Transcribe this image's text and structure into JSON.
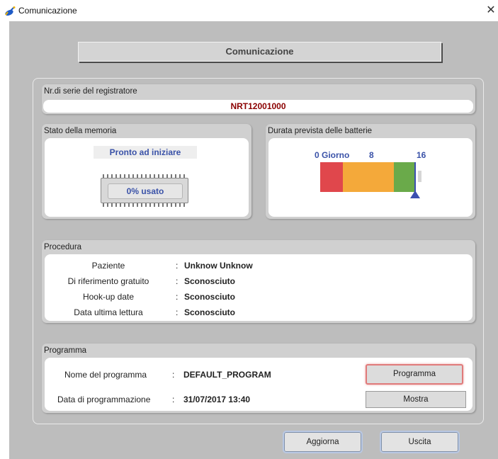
{
  "window": {
    "title": "Comunicazione",
    "close_glyph": "✕"
  },
  "header": {
    "title": "Comunicazione"
  },
  "serial": {
    "label": "Nr.di serie del registratore",
    "value": "NRT12001000"
  },
  "memory": {
    "label": "Stato della memoria",
    "status": "Pronto ad iniziare",
    "usage": "0% usato",
    "used_percent": 0
  },
  "battery": {
    "label": "Durata prevista delle batterie",
    "ticks": [
      "0 Giorno",
      "8",
      "16"
    ],
    "colors": {
      "red": "#e0474c",
      "orange": "#f4a93a",
      "green": "#6aaa4a",
      "marker": "#3b4fb0"
    }
  },
  "procedure": {
    "label": "Procedura",
    "rows": [
      {
        "key": "Paziente",
        "value": "Unknow Unknow"
      },
      {
        "key": "Di riferimento gratuito",
        "value": "Sconosciuto"
      },
      {
        "key": "Hook-up date",
        "value": "Sconosciuto"
      },
      {
        "key": "Data ultima lettura",
        "value": "Sconosciuto"
      }
    ]
  },
  "program": {
    "label": "Programma",
    "name_label": "Nome del programma",
    "name_value": "DEFAULT_PROGRAM",
    "date_label": "Data di programmazione",
    "date_value": "31/07/2017 13:40",
    "program_button": "Programma",
    "show_button": "Mostra"
  },
  "footer": {
    "refresh_button": "Aggiorna",
    "exit_button": "Uscita"
  },
  "icons": {
    "app": "satellite-dish-icon",
    "close": "close-icon"
  }
}
